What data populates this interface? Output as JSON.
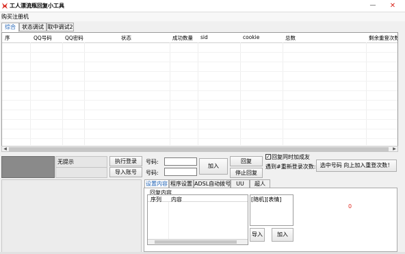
{
  "window": {
    "title": "工人漂流瓶回复小工具",
    "controls": {
      "minimize": "—",
      "close": "✕"
    }
  },
  "menu": {
    "items": [
      "购买注册机"
    ]
  },
  "main_tabs": [
    {
      "label": "综合",
      "active": true
    },
    {
      "label": "状态调试",
      "active": false
    },
    {
      "label": "取中调试2",
      "active": false
    }
  ],
  "grid": {
    "columns": [
      "序",
      "QQ号码",
      "QQ密码",
      "状态",
      "成功数量",
      "sid",
      "cookie",
      "总数",
      "剩余重登次数"
    ]
  },
  "status_panel": {
    "hint": "无提示"
  },
  "actions": {
    "execute_login": "执行登录",
    "import_accounts": "导入账号",
    "number_label_1": "号码:",
    "number_label_2": "号码:",
    "number_value_1": "",
    "number_value_2": "",
    "add": "加入",
    "reply": "回复",
    "stop_reply": "停止回复",
    "add_friend_checkbox": "回复同时加成友",
    "add_friend_checked": true,
    "relogin_text": "遇到#重新登录次数:",
    "select_add_relogin": "选中号码 向上加入重登次数！"
  },
  "sub_tabs": [
    {
      "label": "设置内容",
      "active": true
    },
    {
      "label": "程序设置",
      "active": false
    },
    {
      "label": "ADSL自动拨号",
      "active": false
    },
    {
      "label": "UU",
      "active": false
    },
    {
      "label": "超人",
      "active": false
    }
  ],
  "reply_settings": {
    "section_title": "回复内容",
    "columns": [
      "序列",
      "内容"
    ],
    "textarea_value": "[随机][表情]",
    "count": "0",
    "import": "导入",
    "add": "加入"
  },
  "colors": {
    "accent": "#1a5fb4",
    "count_red": "#e0281e",
    "icon_red": "#d8261c"
  }
}
